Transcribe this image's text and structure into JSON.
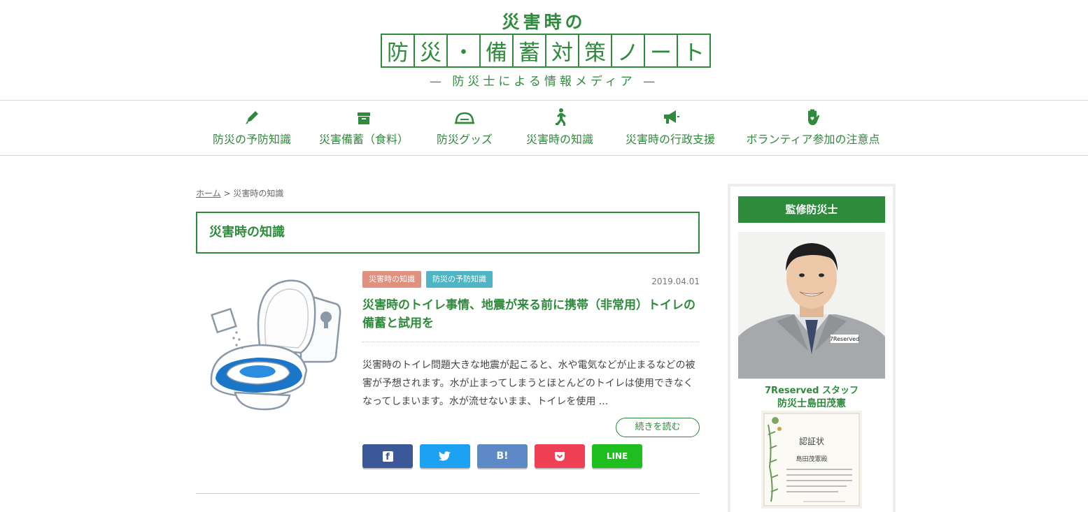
{
  "header": {
    "logo_top": "災害時の",
    "logo_chars": [
      "防",
      "災",
      "・",
      "備",
      "蓄",
      "対",
      "策",
      "ノ",
      "ー",
      "ト"
    ],
    "logo_sub": "— 防災士による情報メディア —"
  },
  "nav": {
    "items": [
      {
        "label": "防災の予防知識",
        "icon": "pen-icon"
      },
      {
        "label": "災害備蓄（食料）",
        "icon": "box-icon"
      },
      {
        "label": "防災グッズ",
        "icon": "helmet-icon"
      },
      {
        "label": "災害時の知識",
        "icon": "running-person-icon"
      },
      {
        "label": "災害時の行政支援",
        "icon": "megaphone-icon"
      },
      {
        "label": "ボランティア参加の注意点",
        "icon": "hand-heart-icon"
      }
    ]
  },
  "breadcrumb": {
    "home": "ホーム",
    "separator": ">",
    "current": "災害時の知識"
  },
  "category_title": "災害時の知識",
  "article": {
    "tags": [
      "災害時の知識",
      "防災の予防知識"
    ],
    "date": "2019.04.01",
    "title": "災害時のトイレ事情、地震が来る前に携帯（非常用）トイレの備蓄と試用を",
    "excerpt": "災害時のトイレ問題大きな地震が起こると、水や電気などが止まるなどの被害が予想されます。水が止まってしまうとほとんどのトイレは使用できなくなってしまいます。水が流せないまま、トイレを使用 ...",
    "more": "続きを読む",
    "share": {
      "facebook": "f",
      "twitter": "twitter",
      "hatena": "B!",
      "pocket": "pocket",
      "line": "LINE"
    }
  },
  "sidebar": {
    "heading": "監修防災士",
    "staff": "7Reserved スタッフ",
    "name": "防災士島田茂憲",
    "badge_text": "7Reserved",
    "cert": {
      "title": "認証状",
      "recipient": "島田茂憲殿"
    }
  },
  "colors": {
    "brand": "#2e8b3c",
    "tag1": "#e0907e",
    "tag2": "#4fb5c4",
    "facebook": "#3b5998",
    "twitter": "#1da1f2",
    "hatena": "#5d8ac6",
    "pocket": "#ef4056",
    "line": "#1dbe1d"
  }
}
